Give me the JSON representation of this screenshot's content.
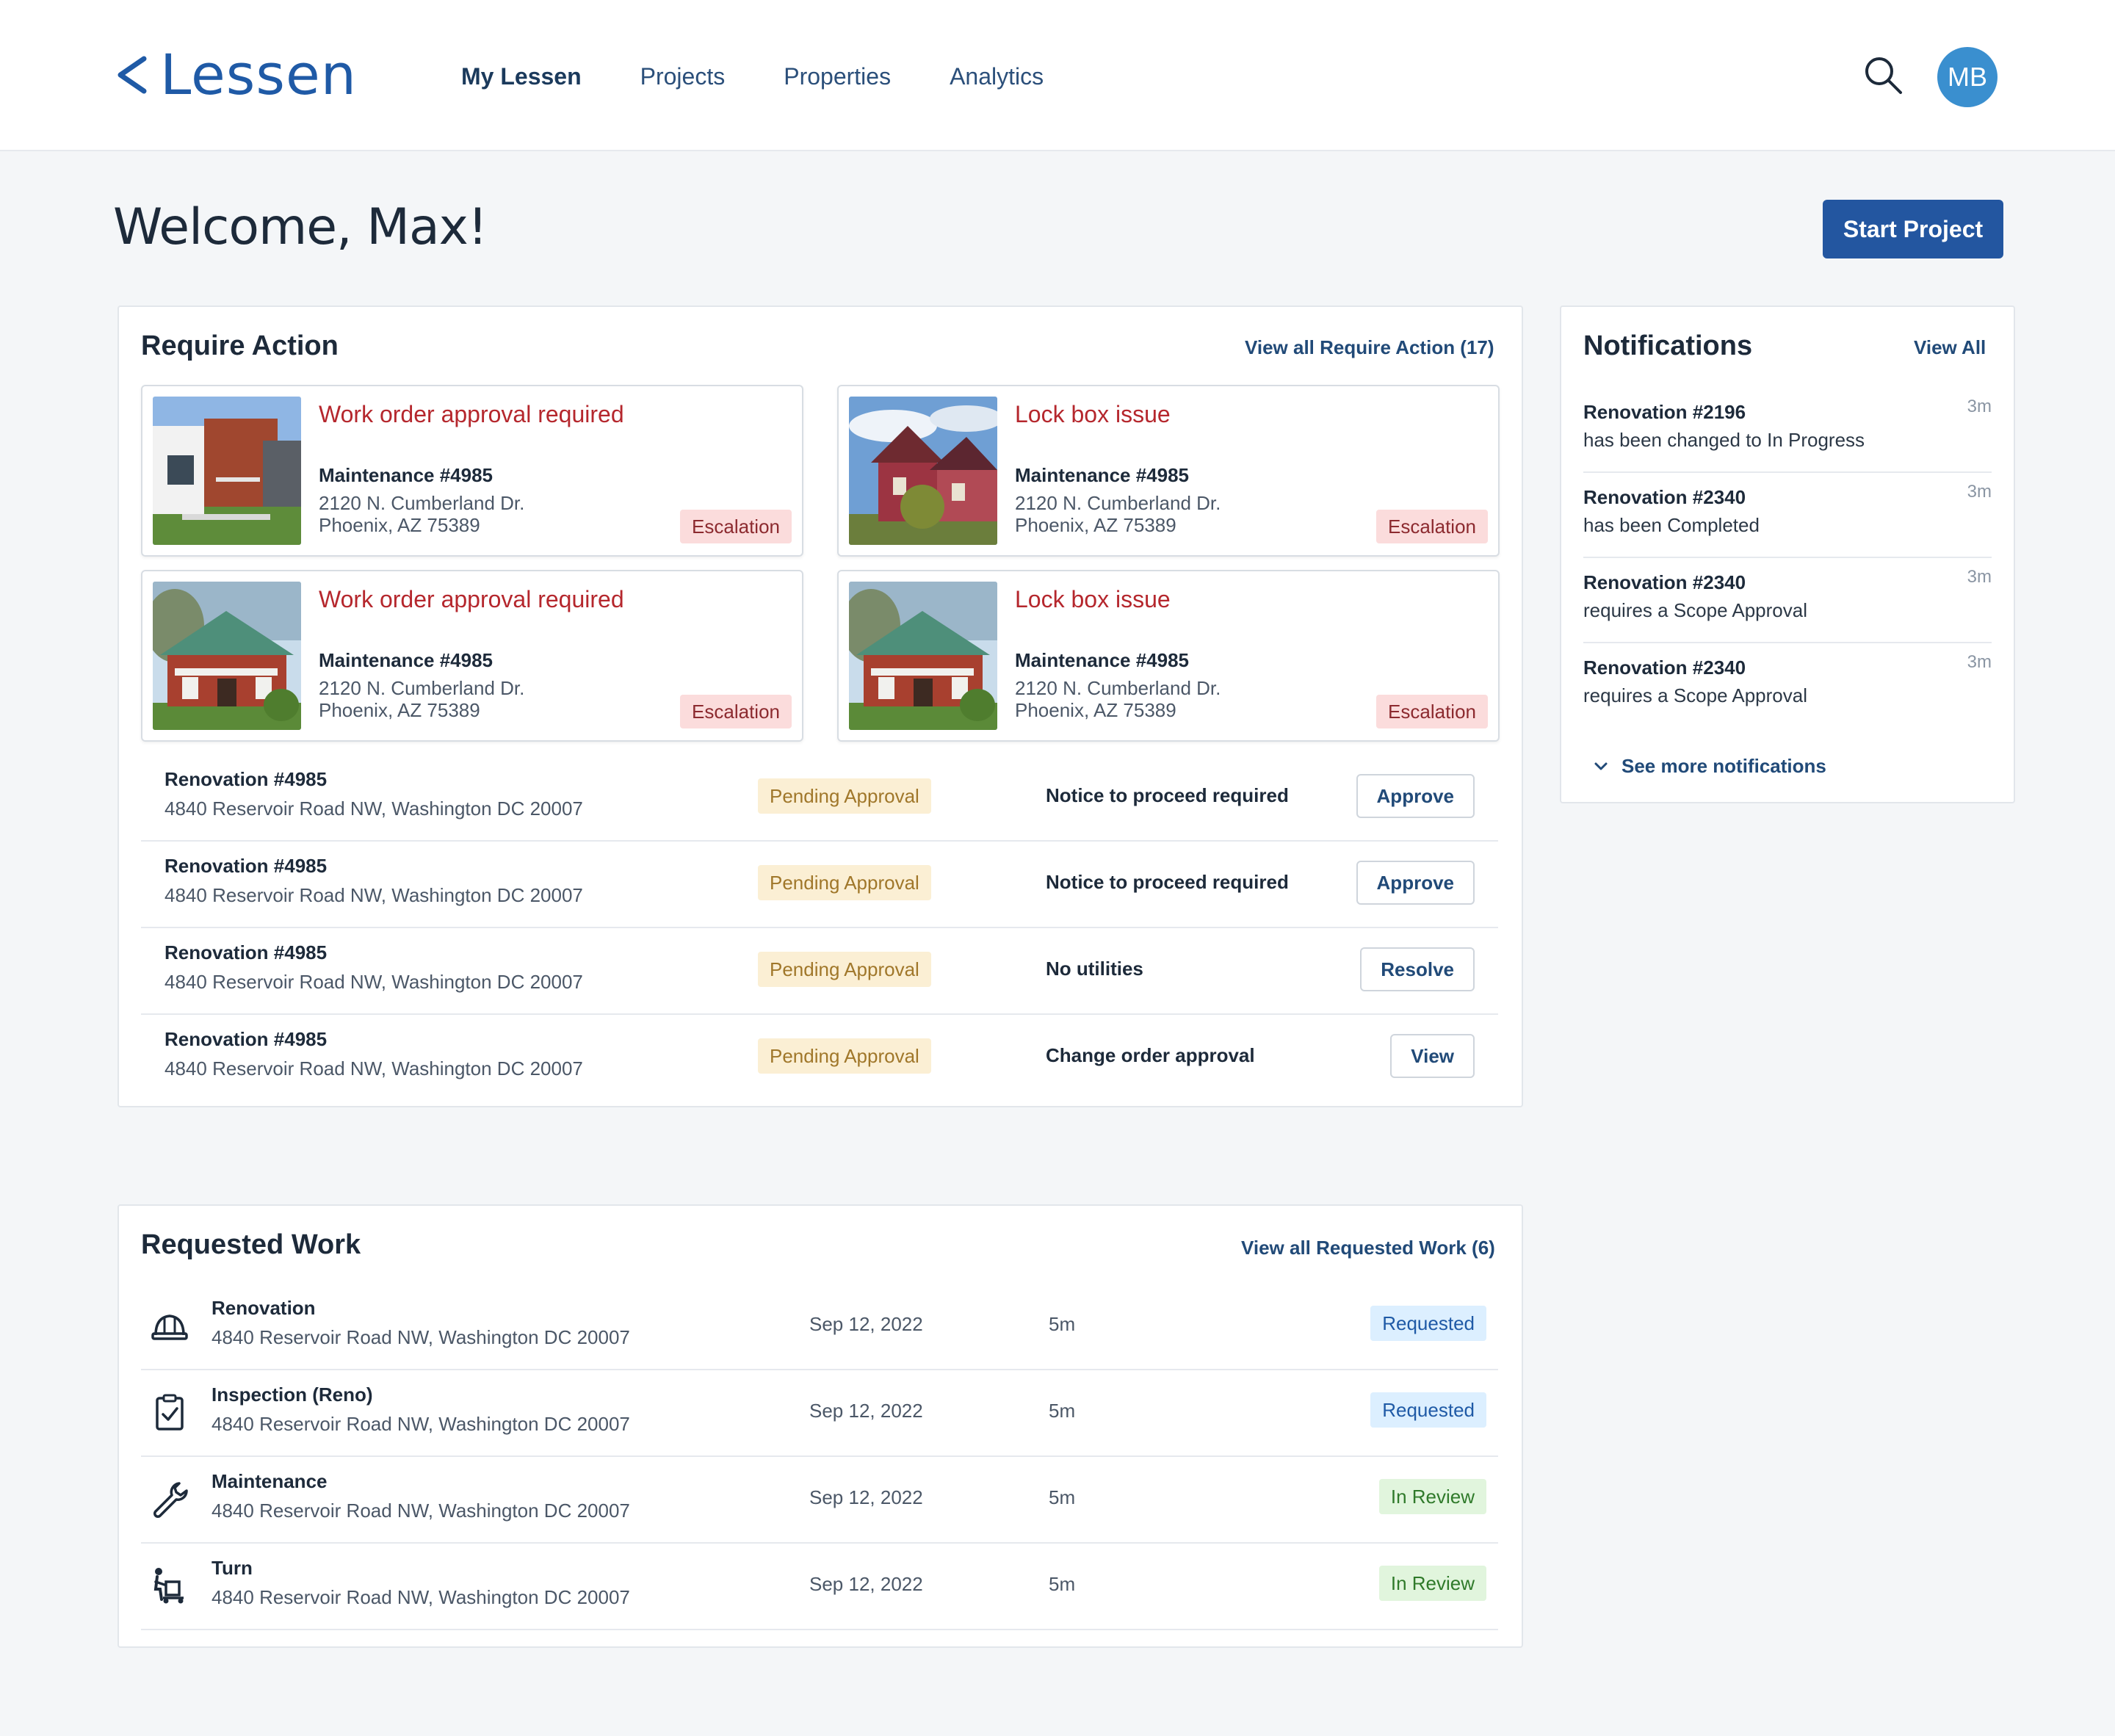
{
  "header": {
    "logo_text": "Lessen",
    "nav": [
      "My Lessen",
      "Projects",
      "Properties",
      "Analytics"
    ],
    "avatar_initials": "MB"
  },
  "welcome": "Welcome, Max!",
  "start_project": "Start Project",
  "require_action": {
    "title": "Require Action",
    "view_all": "View all Require Action (17)",
    "tiles": [
      {
        "title": "Work order approval required",
        "sub": "Maintenance #4985",
        "addr1": "2120 N. Cumberland Dr.",
        "addr2": "Phoenix, AZ 75389",
        "badge": "Escalation",
        "photo": "modern-house"
      },
      {
        "title": "Lock box issue",
        "sub": "Maintenance #4985",
        "addr1": "2120 N. Cumberland Dr.",
        "addr2": "Phoenix, AZ 75389",
        "badge": "Escalation",
        "photo": "red-victorian-house"
      },
      {
        "title": "Work order approval required",
        "sub": "Maintenance #4985",
        "addr1": "2120 N. Cumberland Dr.",
        "addr2": "Phoenix, AZ 75389",
        "badge": "Escalation",
        "photo": "brick-bungalow"
      },
      {
        "title": "Lock box issue",
        "sub": "Maintenance #4985",
        "addr1": "2120 N. Cumberland Dr.",
        "addr2": "Phoenix, AZ 75389",
        "badge": "Escalation",
        "photo": "brick-bungalow"
      }
    ],
    "rows": [
      {
        "title": "Renovation #4985",
        "addr": "4840 Reservoir Road NW, Washington DC 20007",
        "status": "Pending Approval",
        "note": "Notice to proceed required",
        "action": "Approve"
      },
      {
        "title": "Renovation #4985",
        "addr": "4840 Reservoir Road NW, Washington DC 20007",
        "status": "Pending Approval",
        "note": "Notice to proceed required",
        "action": "Approve"
      },
      {
        "title": "Renovation #4985",
        "addr": "4840 Reservoir Road NW, Washington DC 20007",
        "status": "Pending Approval",
        "note": "No utilities",
        "action": "Resolve"
      },
      {
        "title": "Renovation #4985",
        "addr": "4840 Reservoir Road NW, Washington DC 20007",
        "status": "Pending Approval",
        "note": "Change order approval",
        "action": "View"
      }
    ]
  },
  "requested_work": {
    "title": "Requested Work",
    "view_all": "View all Requested Work (6)",
    "rows": [
      {
        "icon": "hard-hat-icon",
        "title": "Renovation",
        "addr": "4840 Reservoir Road NW, Washington DC 20007",
        "date": "Sep 12, 2022",
        "time": "5m",
        "status": "Requested",
        "status_kind": "requested"
      },
      {
        "icon": "clipboard-check-icon",
        "title": "Inspection (Reno)",
        "addr": "4840 Reservoir Road NW, Washington DC 20007",
        "date": "Sep 12, 2022",
        "time": "5m",
        "status": "Requested",
        "status_kind": "requested"
      },
      {
        "icon": "wrench-icon",
        "title": "Maintenance",
        "addr": "4840 Reservoir Road NW, Washington DC 20007",
        "date": "Sep 12, 2022",
        "time": "5m",
        "status": "In Review",
        "status_kind": "review"
      },
      {
        "icon": "dolly-mover-icon",
        "title": "Turn",
        "addr": "4840 Reservoir Road NW, Washington DC 20007",
        "date": "Sep 12, 2022",
        "time": "5m",
        "status": "In Review",
        "status_kind": "review"
      }
    ]
  },
  "notifications": {
    "title": "Notifications",
    "view_all": "View All",
    "items": [
      {
        "title": "Renovation #2196",
        "text": "has been changed to In Progress",
        "time": "3m"
      },
      {
        "title": "Renovation #2340",
        "text": "has been Completed",
        "time": "3m"
      },
      {
        "title": "Renovation #2340",
        "text": "requires a Scope Approval",
        "time": "3m"
      },
      {
        "title": "Renovation #2340",
        "text": "requires a Scope Approval",
        "time": "3m"
      }
    ],
    "see_more": "See more notifications"
  },
  "colors": {
    "brand": "#2356a0",
    "escalation_bg": "#fbdcdc",
    "pending_bg": "#fbefd4",
    "requested_bg": "#dcefff",
    "review_bg": "#e1f5dd",
    "alert_text": "#b5272d"
  }
}
